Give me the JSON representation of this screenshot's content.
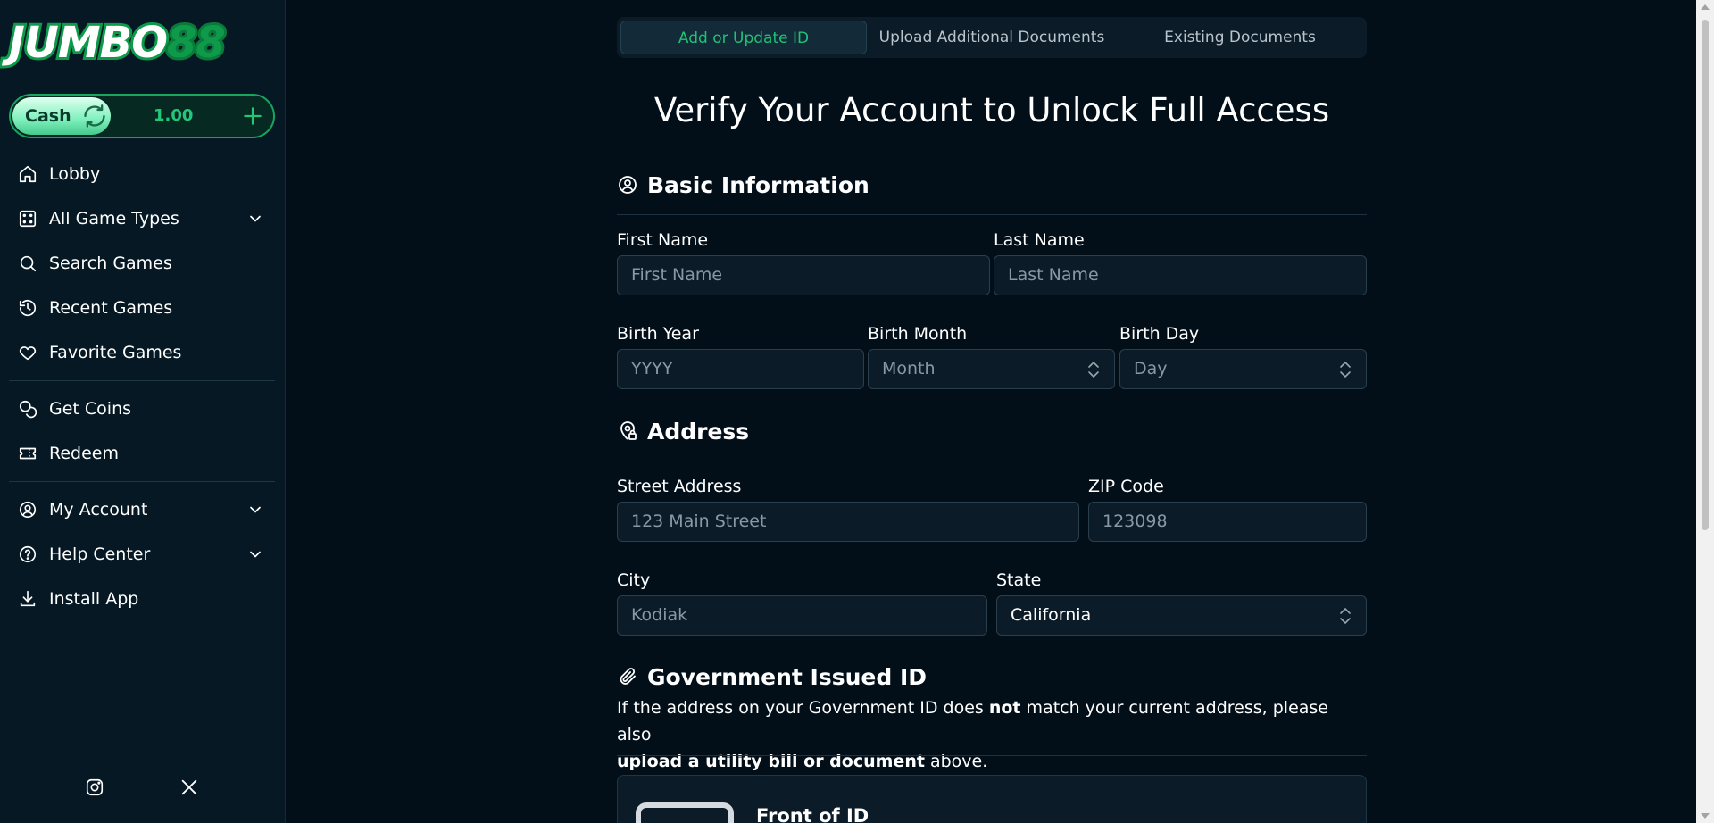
{
  "brand": {
    "logo_text": "JUMBO",
    "logo_number": "88"
  },
  "wallet": {
    "currency_label": "Cash",
    "balance": "1.00"
  },
  "sidebar": {
    "items": [
      {
        "label": "Lobby",
        "icon": "home-icon"
      },
      {
        "label": "All Game Types",
        "icon": "dice-icon",
        "expandable": true
      },
      {
        "label": "Search Games",
        "icon": "search-icon"
      },
      {
        "label": "Recent Games",
        "icon": "history-icon"
      },
      {
        "label": "Favorite Games",
        "icon": "heart-icon"
      },
      {
        "label": "Get Coins",
        "icon": "coins-icon"
      },
      {
        "label": "Redeem",
        "icon": "ticket-icon"
      },
      {
        "label": "My Account",
        "icon": "user-circle-icon",
        "expandable": true
      },
      {
        "label": "Help Center",
        "icon": "help-icon",
        "expandable": true
      },
      {
        "label": "Install App",
        "icon": "download-icon"
      }
    ],
    "social": [
      "instagram-icon",
      "x-icon"
    ]
  },
  "tabs": [
    {
      "label": "Add or Update ID",
      "active": true
    },
    {
      "label": "Upload Additional Documents",
      "active": false
    },
    {
      "label": "Existing Documents",
      "active": false
    }
  ],
  "page_title": "Verify Your Account to Unlock Full Access",
  "basic_info": {
    "title": "Basic Information",
    "first_name": {
      "label": "First Name",
      "placeholder": "First Name",
      "value": ""
    },
    "last_name": {
      "label": "Last Name",
      "placeholder": "Last Name",
      "value": ""
    },
    "birth_year": {
      "label": "Birth Year",
      "placeholder": "YYYY",
      "value": ""
    },
    "birth_month": {
      "label": "Birth Month",
      "selected": "Month"
    },
    "birth_day": {
      "label": "Birth Day",
      "selected": "Day"
    }
  },
  "address": {
    "title": "Address",
    "street": {
      "label": "Street Address",
      "placeholder": "123 Main Street",
      "value": ""
    },
    "zip": {
      "label": "ZIP Code",
      "placeholder": "123098",
      "value": ""
    },
    "city": {
      "label": "City",
      "placeholder": "Kodiak",
      "value": ""
    },
    "state": {
      "label": "State",
      "selected": "California"
    }
  },
  "gov_id": {
    "title": "Government Issued ID",
    "note_part1": "If the address on your Government ID does ",
    "note_bold1": "not",
    "note_part2": " match your current address, please also ",
    "note_bold2": "upload a utility bill or document",
    "note_part3": " above.",
    "front_card_title": "Front of ID"
  },
  "colors": {
    "accent": "#20c275",
    "background": "#020f19",
    "sidebar": "#051824",
    "input": "#0b1b27"
  }
}
